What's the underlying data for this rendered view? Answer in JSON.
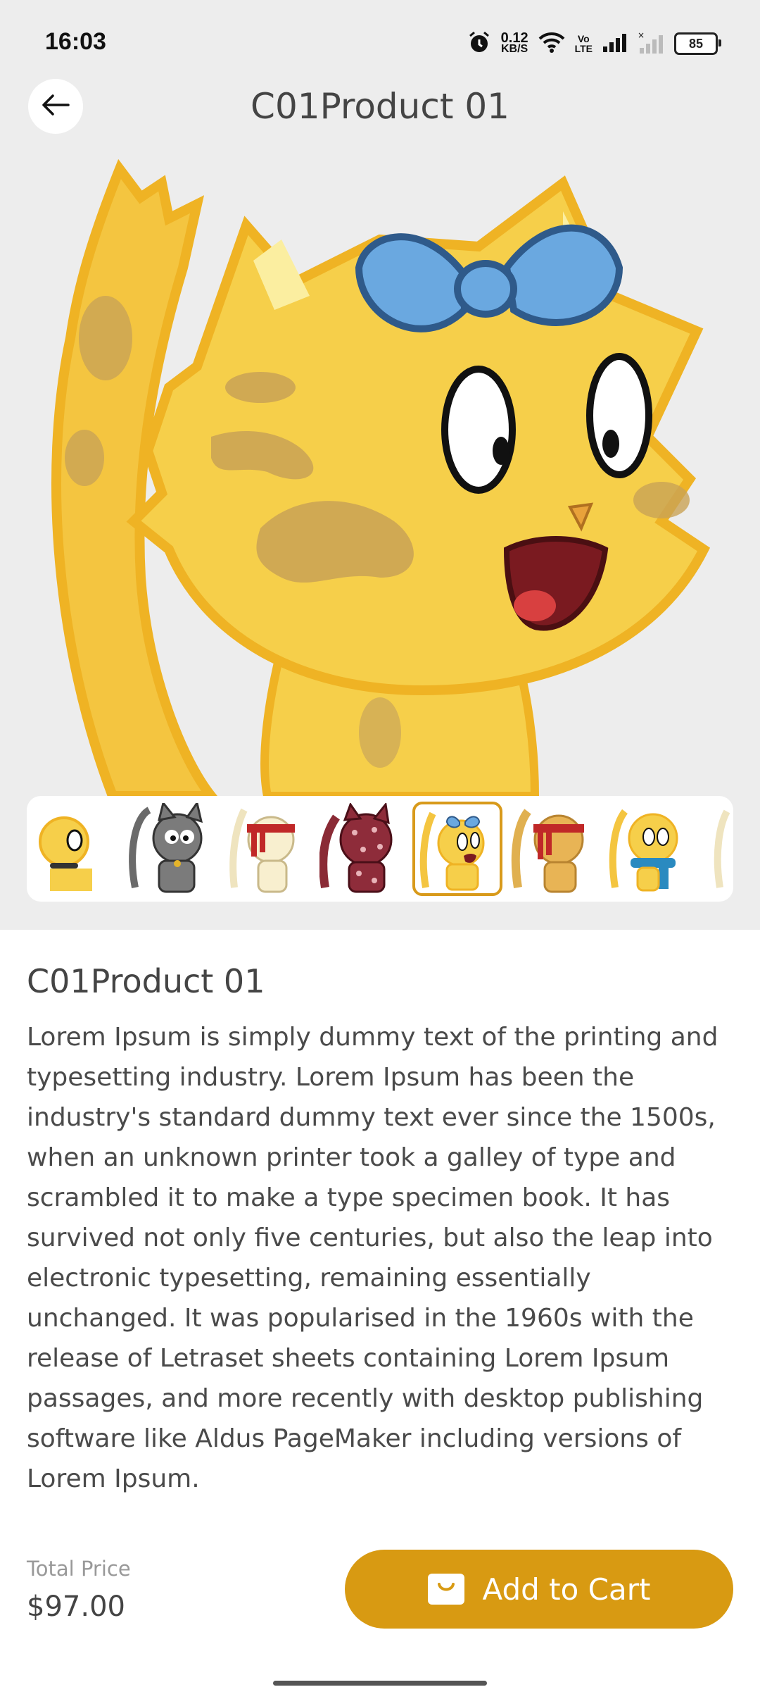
{
  "status_bar": {
    "time": "16:03",
    "net_speed_value": "0.12",
    "net_speed_unit": "KB/S",
    "volte_line1": "Vo",
    "volte_line2": "LTE",
    "battery": "85",
    "icons": [
      "alarm-icon",
      "wifi-icon",
      "volte-icon",
      "signal-icon",
      "signal-no-service-icon",
      "battery-icon"
    ]
  },
  "header": {
    "title": "C01Product 01",
    "back_icon": "arrow-left-icon"
  },
  "gallery": {
    "thumbnails": [
      {
        "name": "yellow-cat-collar"
      },
      {
        "name": "gray-cat"
      },
      {
        "name": "cream-cat-red-headband"
      },
      {
        "name": "maroon-spotted-cat"
      },
      {
        "name": "yellow-cat-blue-bow",
        "selected": true
      },
      {
        "name": "orange-cat-red-headband"
      },
      {
        "name": "yellow-cat-blue-scarf"
      },
      {
        "name": "cream-cat-red-band-partial"
      }
    ],
    "accent_color": "#d89a1b"
  },
  "product": {
    "name": "C01Product 01",
    "description": "Lorem Ipsum is simply dummy text of the printing and typesetting industry. Lorem Ipsum has been the industry's standard dummy text ever since the 1500s, when an unknown printer took a galley of type and scrambled it to make a type specimen book. It has survived not only five centuries, but also the leap into electronic typesetting, remaining essentially unchanged. It was popularised in the 1960s with the release of Letraset sheets containing Lorem Ipsum passages, and more recently with desktop publishing software like Aldus PageMaker including versions of Lorem Ipsum."
  },
  "footer": {
    "price_label": "Total Price",
    "price": "$97.00",
    "add_to_cart_label": "Add to Cart",
    "cart_icon": "shopping-bag-icon",
    "button_color": "#d89a12"
  }
}
